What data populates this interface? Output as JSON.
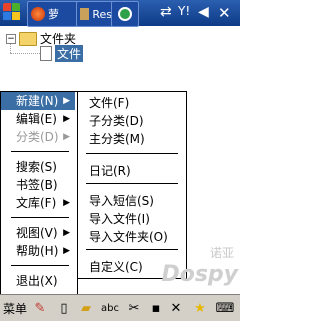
{
  "taskbar": {
    "app_label_1": "萝",
    "app_label_2": "Res",
    "tray_icons": [
      "sync-icon",
      "signal-icon",
      "volume-icon",
      "close-icon"
    ]
  },
  "tree": {
    "root_label": "文件夹",
    "child_label": "文件"
  },
  "main_menu": {
    "items": [
      {
        "label": "新建(N)",
        "has_submenu": true,
        "state": "highlighted"
      },
      {
        "label": "编辑(E)",
        "has_submenu": true,
        "state": "normal"
      },
      {
        "label": "分类(D)",
        "has_submenu": true,
        "state": "disabled"
      },
      {
        "label": "搜索(S)",
        "has_submenu": false,
        "state": "normal"
      },
      {
        "label": "书签(B)",
        "has_submenu": false,
        "state": "normal"
      },
      {
        "label": "文库(F)",
        "has_submenu": true,
        "state": "normal"
      },
      {
        "label": "视图(V)",
        "has_submenu": true,
        "state": "normal"
      },
      {
        "label": "帮助(H)",
        "has_submenu": true,
        "state": "normal"
      },
      {
        "label": "退出(X)",
        "has_submenu": false,
        "state": "normal"
      }
    ]
  },
  "sub_menu": {
    "items": [
      {
        "label": "文件(F)"
      },
      {
        "label": "子分类(D)"
      },
      {
        "label": "主分类(M)"
      },
      {
        "label": "日记(R)"
      },
      {
        "label": "导入短信(S)"
      },
      {
        "label": "导入文件(I)"
      },
      {
        "label": "导入文件夹(O)"
      },
      {
        "label": "自定义(C)"
      }
    ]
  },
  "bottom_bar": {
    "menu_label": "菜单",
    "spell_label": "abc",
    "tools": [
      "edit-icon",
      "new-document-icon",
      "open-folder-icon",
      "spellcheck-icon",
      "cut-icon",
      "save-icon",
      "delete-icon",
      "favorite-icon",
      "keyboard-icon"
    ]
  },
  "watermark": {
    "brand": "Dospy",
    "cn": "诺亚"
  },
  "colors": {
    "taskbar": "#0d3a86",
    "highlight": "#3a6ea5",
    "bottom_bar": "#d4d0c8"
  }
}
